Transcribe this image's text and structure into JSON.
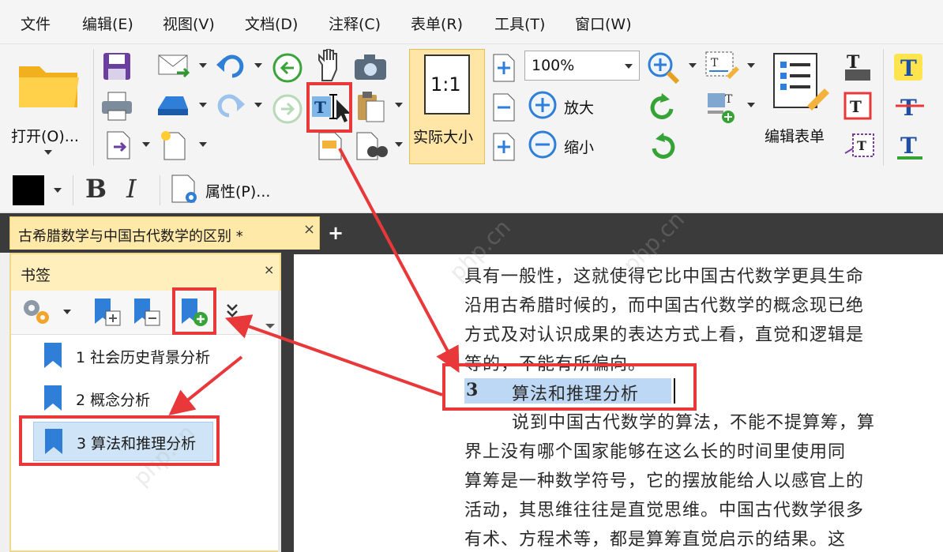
{
  "menu": {
    "items": [
      "文件",
      "编辑(E)",
      "视图(V)",
      "文档(D)",
      "注释(C)",
      "表单(R)",
      "工具(T)",
      "窗口(W)"
    ]
  },
  "ribbon": {
    "open_label": "打开(O)...",
    "zoom_value": "100%",
    "actual_size_label": "实际大小",
    "actual_size_glyph": "1:1",
    "zoom_in_label": "放大",
    "zoom_out_label": "缩小",
    "edit_form_label": "编辑表单"
  },
  "format": {
    "bold_label": "B",
    "italic_label": "I",
    "properties_label": "属性(P)..."
  },
  "tabs": {
    "doc_tab": "古希腊数学与中国古代数学的区别 *",
    "close_glyph": "×",
    "new_tab_glyph": "+"
  },
  "bookmarks": {
    "title": "书签",
    "close_glyph": "×",
    "items": [
      {
        "label": "1 社会历史背景分析"
      },
      {
        "label": "2 概念分析"
      },
      {
        "label": "3 算法和推理分析"
      }
    ]
  },
  "document": {
    "lines": [
      "具有一般性，这就使得它比中国古代数学更具生命",
      "沿用古希腊时候的，而中国古代数学的概念现已绝",
      "方式及对认识成果的表达方式上看，直觉和逻辑是",
      "等的，不能有所偏向。",
      "说到中国古代数学的算法，不能不提算筹，算",
      "界上没有哪个国家能够在这么长的时间里使用同",
      "算筹是一种数学符号，它的摆放能给人以感官上的",
      "活动，其思维往往是直觉思维。中国古代数学很多",
      "有术、方程术等，都是算筹直觉启示的结果。这"
    ],
    "heading_number": "3",
    "heading_text": "算法和推理分析"
  },
  "watermark": "php.cn",
  "colors": {
    "accent_red": "#e8383a",
    "selection_blue": "#bcd8f4",
    "tab_yellow": "#ffe9a8"
  }
}
